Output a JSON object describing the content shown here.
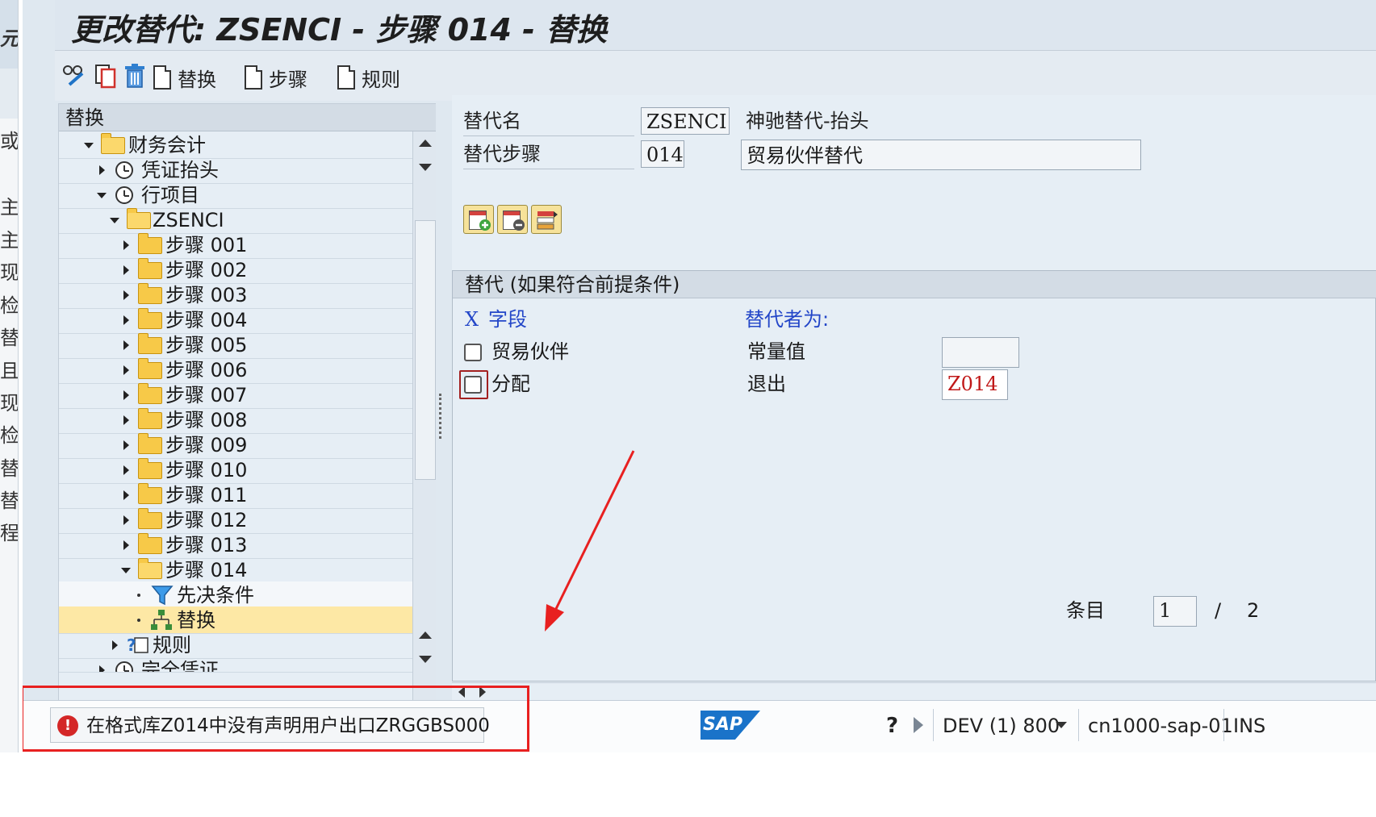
{
  "title": "更改替代: ZSENCI - 步骤 014 - 替换",
  "background_window_fragments": [
    "元",
    "或",
    "主",
    "主",
    "现",
    "检",
    "替",
    "且",
    "现",
    "检",
    "替",
    "替",
    "程"
  ],
  "toolbar": {
    "icons": [
      "glasses-edit-icon",
      "copy-icon",
      "trash-icon"
    ],
    "buttons": [
      {
        "label": "替换",
        "icon": "document-icon"
      },
      {
        "label": "步骤",
        "icon": "document-icon"
      },
      {
        "label": "规则",
        "icon": "document-icon"
      }
    ]
  },
  "tree": {
    "header": "替换",
    "nodes": [
      {
        "label": "财务会计"
      },
      {
        "label": "凭证抬头"
      },
      {
        "label": "行项目"
      },
      {
        "label": "ZSENCI"
      },
      {
        "label": "步骤 001"
      },
      {
        "label": "步骤 002"
      },
      {
        "label": "步骤 003"
      },
      {
        "label": "步骤 004"
      },
      {
        "label": "步骤 005"
      },
      {
        "label": "步骤 006"
      },
      {
        "label": "步骤 007"
      },
      {
        "label": "步骤 008"
      },
      {
        "label": "步骤 009"
      },
      {
        "label": "步骤 010"
      },
      {
        "label": "步骤 011"
      },
      {
        "label": "步骤 012"
      },
      {
        "label": "步骤 013"
      },
      {
        "label": "步骤 014"
      },
      {
        "label": "先决条件"
      },
      {
        "label": "替换"
      },
      {
        "label": "规则"
      },
      {
        "label": "完全凭证"
      }
    ]
  },
  "form": {
    "substitution_name_label": "替代名",
    "substitution_name_value": "ZSENCI",
    "substitution_name_desc": "神驰替代-抬头",
    "step_label": "替代步骤",
    "step_value": "014",
    "step_desc": "贸易伙伴替代"
  },
  "group": {
    "title": "替代 (如果符合前提条件)",
    "col_x": "X",
    "col_field": "字段",
    "col_replaced_by": "替代者为:",
    "rows": [
      {
        "field": "贸易伙伴",
        "type": "常量值",
        "value": ""
      },
      {
        "field": "分配",
        "type": "退出",
        "value": "Z014"
      }
    ],
    "entries_label": "条目",
    "entries_current": "1",
    "entries_sep": "/",
    "entries_total": "2"
  },
  "status": {
    "message": "在格式库Z014中没有声明用户出口ZRGGBS000",
    "message_type": "error",
    "logo": "SAP",
    "system": "DEV (1) 800",
    "server": "cn1000-sap-01",
    "mode": "INS"
  },
  "colors": {
    "highlight_red": "#e82020",
    "selected_row": "#fde8a5",
    "field_link_blue": "#2346c8",
    "exit_value_red": "#c01818"
  }
}
